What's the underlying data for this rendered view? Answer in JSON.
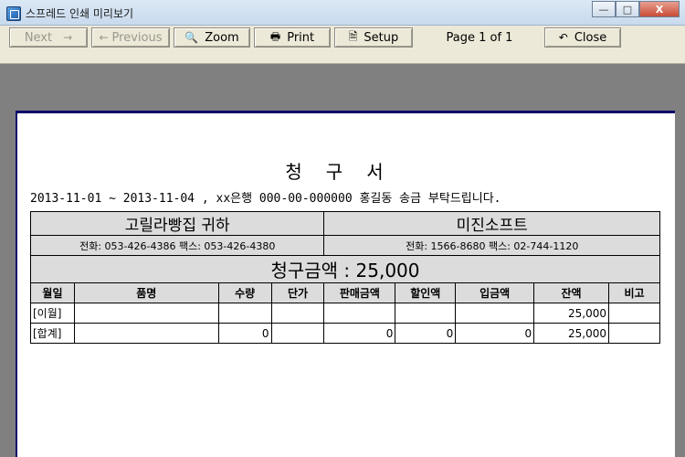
{
  "window": {
    "title": "스프레드 인쇄 미리보기",
    "min": "—",
    "max": "□",
    "close": "X"
  },
  "toolbar": {
    "next": "Next",
    "previous": "Previous",
    "zoom": "Zoom",
    "print": "Print",
    "setup": "Setup",
    "page": "Page 1 of 1",
    "close": "Close"
  },
  "doc": {
    "title": "청구서",
    "note": "2013-11-01 ~ 2013-11-04 , xx은행 000-00-000000 홍길동 송금 부탁드립니다.",
    "to_name": "고릴라빵집 귀하",
    "from_name": "미진소프트",
    "to_contact": "전화: 053-426-4386   팩스: 053-426-4380",
    "from_contact": "전화: 1566-8680   팩스: 02-744-1120",
    "total_amount": "청구금액 : 25,000",
    "columns": [
      "월일",
      "품명",
      "수량",
      "단가",
      "판매금액",
      "할인액",
      "입금액",
      "잔액",
      "비고"
    ],
    "rows": [
      [
        "[이월]",
        "",
        "",
        "",
        "",
        "",
        "",
        "25,000",
        ""
      ],
      [
        "[합계]",
        "",
        "0",
        "",
        "0",
        "0",
        "0",
        "25,000",
        ""
      ]
    ]
  }
}
